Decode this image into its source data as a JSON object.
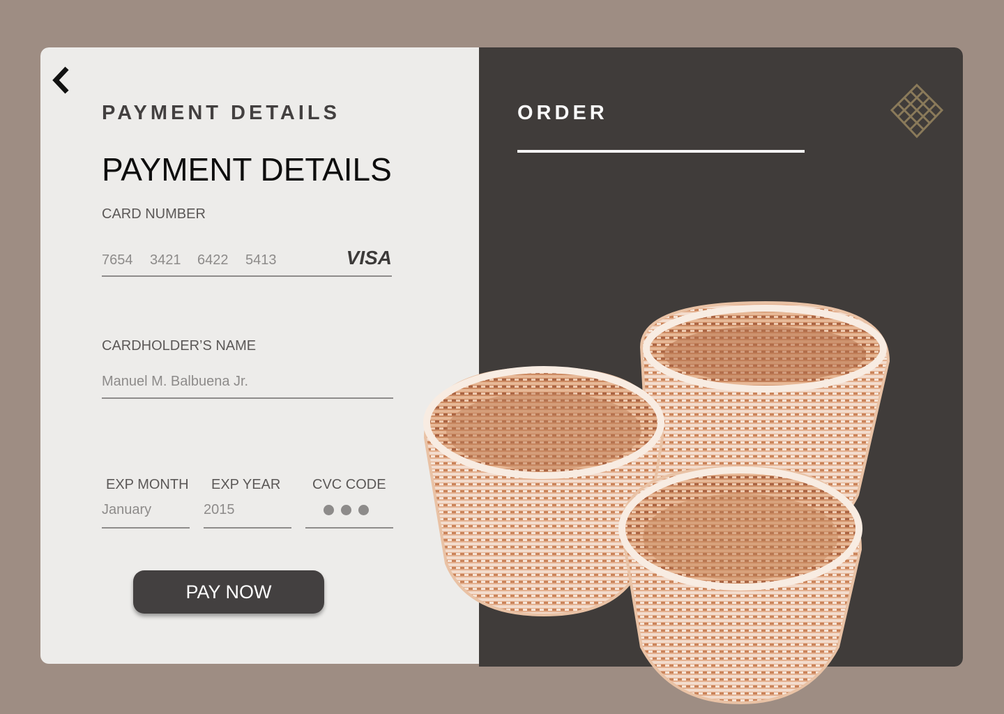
{
  "header": {
    "eyebrow": "PAYMENT DETAILS",
    "title": "PAYMENT DETAILS"
  },
  "form": {
    "card_number_label": "CARD NUMBER",
    "card_number_groups": [
      "7654",
      "3421",
      "6422",
      "5413"
    ],
    "card_brand": "VISA",
    "cardholder_label": "CARDHOLDER’S NAME",
    "cardholder_value": "Manuel M. Balbuena Jr.",
    "exp_month_label": "EXP MONTH",
    "exp_month_value": "January",
    "exp_year_label": "EXP YEAR",
    "exp_year_value": "2015",
    "cvc_label": "CVC CODE",
    "pay_button": "PAY NOW"
  },
  "order": {
    "title": "ORDER"
  },
  "icons": {
    "back": "chevron-left-icon",
    "logo": "woven-knot-logo"
  },
  "colors": {
    "background": "#9e8d83",
    "left_panel": "#edecea",
    "right_panel": "#403c3a",
    "button": "#434040",
    "logo": "#8a7a5a"
  }
}
